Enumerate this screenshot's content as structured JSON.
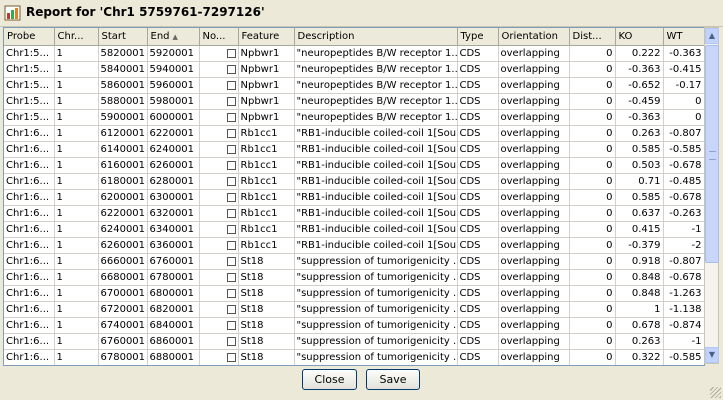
{
  "window": {
    "title": "Report for 'Chr1 5759761-7297126'",
    "icon": "chart-report-icon"
  },
  "table": {
    "columns": [
      "Probe",
      "Chr...",
      "Start",
      "End",
      "No...",
      "Feature",
      "Description",
      "Type",
      "Orientation",
      "Dist...",
      "KO",
      "WT"
    ],
    "sorted_column": "End",
    "rows": [
      [
        "Chr1:5...",
        "1",
        "5820001",
        "5920001",
        "",
        "Npbwr1",
        "\"neuropeptides B/W receptor 1...",
        "CDS",
        "overlapping",
        "0",
        "0.222",
        "-0.363"
      ],
      [
        "Chr1:5...",
        "1",
        "5840001",
        "5940001",
        "",
        "Npbwr1",
        "\"neuropeptides B/W receptor 1...",
        "CDS",
        "overlapping",
        "0",
        "-0.363",
        "-0.415"
      ],
      [
        "Chr1:5...",
        "1",
        "5860001",
        "5960001",
        "",
        "Npbwr1",
        "\"neuropeptides B/W receptor 1...",
        "CDS",
        "overlapping",
        "0",
        "-0.652",
        "-0.17"
      ],
      [
        "Chr1:5...",
        "1",
        "5880001",
        "5980001",
        "",
        "Npbwr1",
        "\"neuropeptides B/W receptor 1...",
        "CDS",
        "overlapping",
        "0",
        "-0.459",
        "0"
      ],
      [
        "Chr1:5...",
        "1",
        "5900001",
        "6000001",
        "",
        "Npbwr1",
        "\"neuropeptides B/W receptor 1...",
        "CDS",
        "overlapping",
        "0",
        "-0.363",
        "0"
      ],
      [
        "Chr1:6...",
        "1",
        "6120001",
        "6220001",
        "",
        "Rb1cc1",
        "\"RB1-inducible coiled-coil 1[Sou...",
        "CDS",
        "overlapping",
        "0",
        "0.263",
        "-0.807"
      ],
      [
        "Chr1:6...",
        "1",
        "6140001",
        "6240001",
        "",
        "Rb1cc1",
        "\"RB1-inducible coiled-coil 1[Sou...",
        "CDS",
        "overlapping",
        "0",
        "0.585",
        "-0.585"
      ],
      [
        "Chr1:6...",
        "1",
        "6160001",
        "6260001",
        "",
        "Rb1cc1",
        "\"RB1-inducible coiled-coil 1[Sou...",
        "CDS",
        "overlapping",
        "0",
        "0.503",
        "-0.678"
      ],
      [
        "Chr1:6...",
        "1",
        "6180001",
        "6280001",
        "",
        "Rb1cc1",
        "\"RB1-inducible coiled-coil 1[Sou...",
        "CDS",
        "overlapping",
        "0",
        "0.71",
        "-0.485"
      ],
      [
        "Chr1:6...",
        "1",
        "6200001",
        "6300001",
        "",
        "Rb1cc1",
        "\"RB1-inducible coiled-coil 1[Sou...",
        "CDS",
        "overlapping",
        "0",
        "0.585",
        "-0.678"
      ],
      [
        "Chr1:6...",
        "1",
        "6220001",
        "6320001",
        "",
        "Rb1cc1",
        "\"RB1-inducible coiled-coil 1[Sou...",
        "CDS",
        "overlapping",
        "0",
        "0.637",
        "-0.263"
      ],
      [
        "Chr1:6...",
        "1",
        "6240001",
        "6340001",
        "",
        "Rb1cc1",
        "\"RB1-inducible coiled-coil 1[Sou...",
        "CDS",
        "overlapping",
        "0",
        "0.415",
        "-1"
      ],
      [
        "Chr1:6...",
        "1",
        "6260001",
        "6360001",
        "",
        "Rb1cc1",
        "\"RB1-inducible coiled-coil 1[Sou...",
        "CDS",
        "overlapping",
        "0",
        "-0.379",
        "-2"
      ],
      [
        "Chr1:6...",
        "1",
        "6660001",
        "6760001",
        "",
        "St18",
        "\"suppression of tumorigenicity ...",
        "CDS",
        "overlapping",
        "0",
        "0.918",
        "-0.807"
      ],
      [
        "Chr1:6...",
        "1",
        "6680001",
        "6780001",
        "",
        "St18",
        "\"suppression of tumorigenicity ...",
        "CDS",
        "overlapping",
        "0",
        "0.848",
        "-0.678"
      ],
      [
        "Chr1:6...",
        "1",
        "6700001",
        "6800001",
        "",
        "St18",
        "\"suppression of tumorigenicity ...",
        "CDS",
        "overlapping",
        "0",
        "0.848",
        "-1.263"
      ],
      [
        "Chr1:6...",
        "1",
        "6720001",
        "6820001",
        "",
        "St18",
        "\"suppression of tumorigenicity ...",
        "CDS",
        "overlapping",
        "0",
        "1",
        "-1.138"
      ],
      [
        "Chr1:6...",
        "1",
        "6740001",
        "6840001",
        "",
        "St18",
        "\"suppression of tumorigenicity ...",
        "CDS",
        "overlapping",
        "0",
        "0.678",
        "-0.874"
      ],
      [
        "Chr1:6...",
        "1",
        "6760001",
        "6860001",
        "",
        "St18",
        "\"suppression of tumorigenicity ...",
        "CDS",
        "overlapping",
        "0",
        "0.263",
        "-1"
      ],
      [
        "Chr1:6...",
        "1",
        "6780001",
        "6880001",
        "",
        "St18",
        "\"suppression of tumorigenicity ...",
        "CDS",
        "overlapping",
        "0",
        "0.322",
        "-0.585"
      ]
    ]
  },
  "buttons": {
    "close": "Close",
    "save": "Save"
  },
  "colors": {
    "window_bg": "#ece9d8",
    "grid_line": "#d4d0c8",
    "border_blue": "#7f9db9"
  }
}
